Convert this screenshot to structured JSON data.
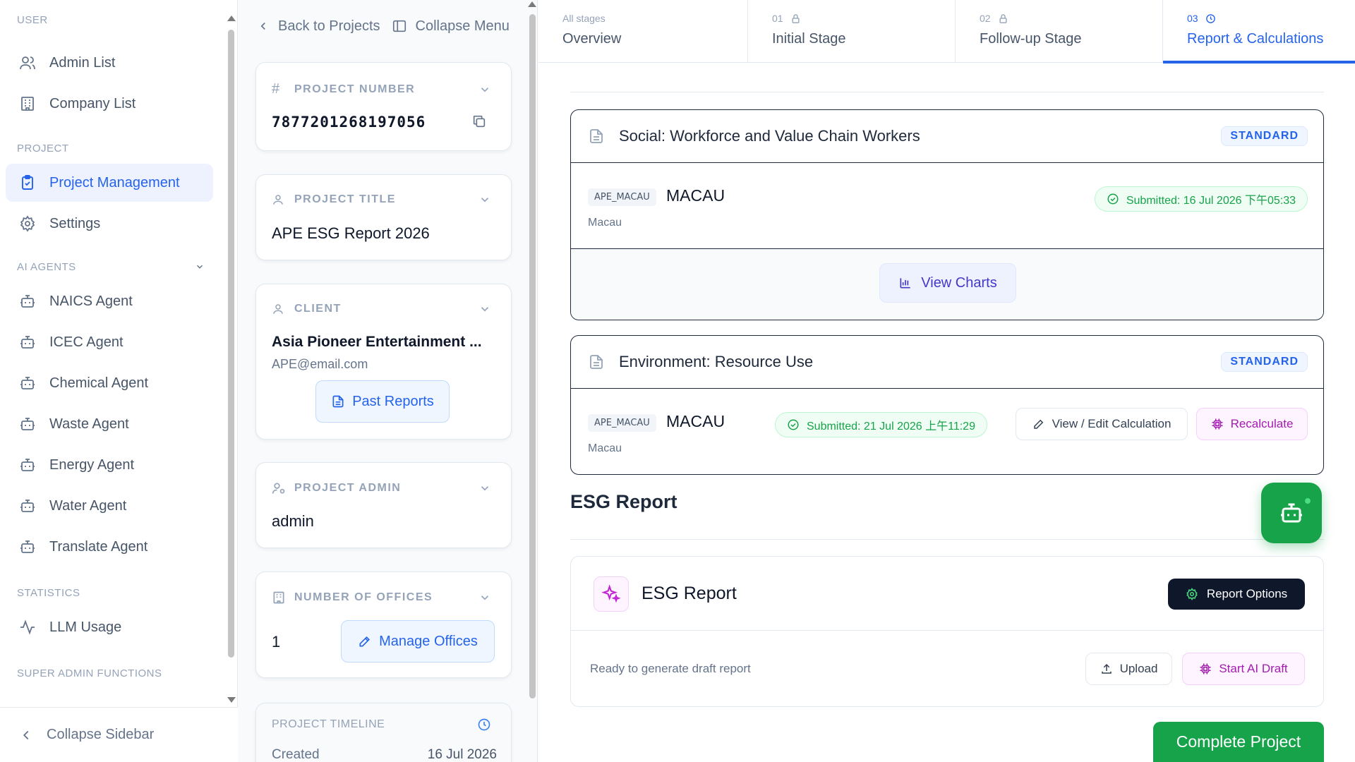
{
  "sidebar": {
    "sections": {
      "user": "USER",
      "project": "PROJECT",
      "ai_agents": "AI AGENTS",
      "statistics": "STATISTICS",
      "super_admin": "SUPER ADMIN FUNCTIONS"
    },
    "items": {
      "admin_list": "Admin List",
      "company_list": "Company List",
      "project_management": "Project Management",
      "settings": "Settings",
      "naics": "NAICS Agent",
      "icec": "ICEC Agent",
      "chemical": "Chemical Agent",
      "waste": "Waste Agent",
      "energy": "Energy Agent",
      "water": "Water Agent",
      "translate": "Translate Agent",
      "llm_usage": "LLM Usage"
    },
    "collapse": "Collapse Sidebar"
  },
  "panel": {
    "back": "Back to Projects",
    "collapse_menu": "Collapse Menu",
    "project_number": {
      "label": "PROJECT NUMBER",
      "value": "7877201268197056"
    },
    "project_title": {
      "label": "PROJECT TITLE",
      "value": "APE ESG Report 2026"
    },
    "client": {
      "label": "CLIENT",
      "name": "Asia Pioneer Entertainment ...",
      "email": "APE@email.com",
      "past_reports": "Past Reports"
    },
    "project_admin": {
      "label": "PROJECT ADMIN",
      "value": "admin"
    },
    "offices": {
      "label": "NUMBER OF OFFICES",
      "value": "1",
      "manage": "Manage Offices"
    },
    "timeline": {
      "label": "PROJECT TIMELINE",
      "created_label": "Created",
      "created_value": "16 Jul 2026"
    }
  },
  "tabs": [
    {
      "num": "All stages",
      "label": "Overview"
    },
    {
      "num": "01",
      "label": "Initial Stage"
    },
    {
      "num": "02",
      "label": "Follow-up Stage"
    },
    {
      "num": "03",
      "label": "Report & Calculations"
    }
  ],
  "sections": [
    {
      "title": "Social: Workforce and Value Chain Workers",
      "badge": "STANDARD",
      "office_code": "APE_MACAU",
      "office_name": "MACAU",
      "office_sub": "Macau",
      "status": "Submitted: 16 Jul 2026 下午05:33",
      "view_charts": "View Charts"
    },
    {
      "title": "Environment: Resource Use",
      "badge": "STANDARD",
      "office_code": "APE_MACAU",
      "office_name": "MACAU",
      "office_sub": "Macau",
      "status": "Submitted: 21 Jul 2026 上午11:29",
      "view_edit": "View / Edit Calculation",
      "recalculate": "Recalculate"
    }
  ],
  "esg": {
    "heading": "ESG Report",
    "card_title": "ESG Report",
    "report_options": "Report Options",
    "status": "Ready to generate draft report",
    "upload": "Upload",
    "start_ai": "Start AI Draft"
  },
  "complete_project": "Complete Project",
  "colors": {
    "accent": "#2563eb",
    "success": "#16a34a",
    "purple": "#a21caf",
    "dark": "#0f172a"
  }
}
